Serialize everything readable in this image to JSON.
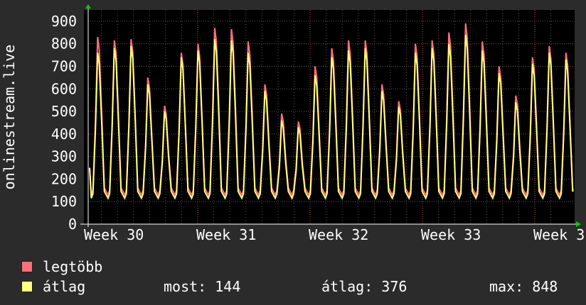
{
  "colors": {
    "background": "#2b2b2b",
    "plot_bg": "#000000",
    "max_line": "#ff6f7a",
    "avg_line": "#ffff80",
    "grid": "#5a5a5a",
    "vgrid": "#a04040",
    "text": "#ffffff",
    "arrow": "#00cc00"
  },
  "chart_data": {
    "type": "line",
    "ylabel": "onlinestream.live",
    "ylim": [
      0,
      950
    ],
    "y_ticks": [
      0,
      100,
      200,
      300,
      400,
      500,
      600,
      700,
      800,
      900
    ],
    "x_ticks": [
      "Week 30",
      "Week 31",
      "Week 32",
      "Week 33",
      "Week 3"
    ],
    "grid": true,
    "series": [
      {
        "name": "legtöbb",
        "color": "#ff6f7a",
        "daily_peaks": [
          830,
          815,
          820,
          650,
          525,
          760,
          800,
          870,
          865,
          810,
          620,
          490,
          455,
          700,
          780,
          815,
          815,
          620,
          545,
          800,
          815,
          850,
          890,
          810,
          700,
          570,
          740,
          790,
          760
        ]
      },
      {
        "name": "átlag",
        "color": "#ffff80",
        "daily_peaks": [
          760,
          780,
          790,
          620,
          500,
          740,
          770,
          820,
          815,
          760,
          590,
          460,
          430,
          660,
          740,
          770,
          780,
          590,
          520,
          760,
          780,
          800,
          840,
          770,
          670,
          540,
          710,
          760,
          730
        ]
      }
    ]
  },
  "legend": [
    {
      "label": "legtöbb",
      "color": "#ff6f7a"
    },
    {
      "label": "átlag",
      "color": "#ffff80"
    }
  ],
  "stats": {
    "now": "most: 144",
    "avg": "átlag: 376",
    "max": "max: 848"
  }
}
